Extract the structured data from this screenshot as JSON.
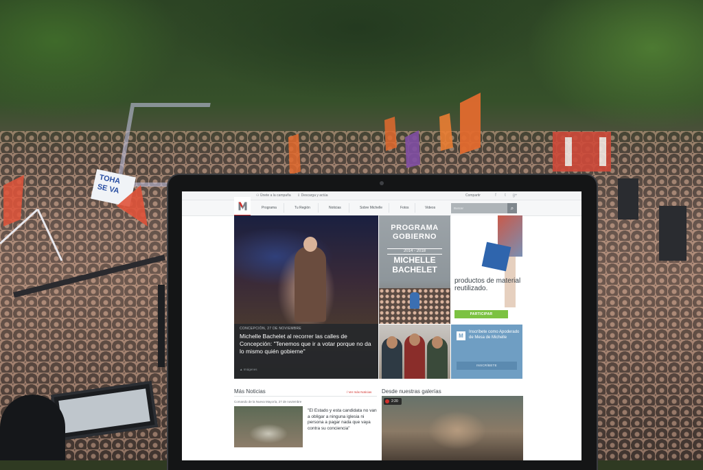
{
  "background": {
    "sign_text": "TOHA\nSE VA"
  },
  "topbar": {
    "link1": "Únete a la campaña",
    "link2": "Descarga y actúa",
    "share_label": "Compartir",
    "social": [
      "f",
      "t",
      "g+"
    ]
  },
  "nav": {
    "items": [
      "Programa",
      "Tu Región",
      "Noticias",
      "Sobre Michelle",
      "Fotos",
      "Videos"
    ],
    "search_placeholder": "Buscar"
  },
  "hero": {
    "date": "CONCEPCIÓN, 27 DE NOVIEMBRE",
    "headline": "Michelle Bachelet al recorrer las calles de Concepción: \"Tenemos que ir a votar porque no da lo mismo quién gobierne\"",
    "images_label": "Imágenes"
  },
  "programa": {
    "line1": "PROGRAMA",
    "line2": "GOBIERNO",
    "years": "2014 - 2018",
    "line3": "MICHELLE",
    "line4": "BACHELET"
  },
  "reciclaje": {
    "text": "productos de material reutilizado.",
    "button": "PARTICIPAR"
  },
  "inscribete": {
    "text": "Inscríbete como Apoderado de Mesa de Michelle",
    "button": "INSCRÍBETE",
    "icon_letter": "M"
  },
  "news": {
    "title": "Más Noticias",
    "more_link": "/ Ver más Noticias",
    "meta": "Comando de la Nueva Mayoría, 27 de noviembre",
    "quote": "\"El Estado y esta candidata no van a obligar a ninguna iglesia ni persona a pagar nada que vaya contra su conciencia\""
  },
  "gallery": {
    "title": "Desde nuestras galerías",
    "count": "2:20"
  },
  "colors": {
    "brand_red": "#d2312d",
    "green_button": "#7cc242",
    "blue_tile": "#6f9ec3"
  }
}
